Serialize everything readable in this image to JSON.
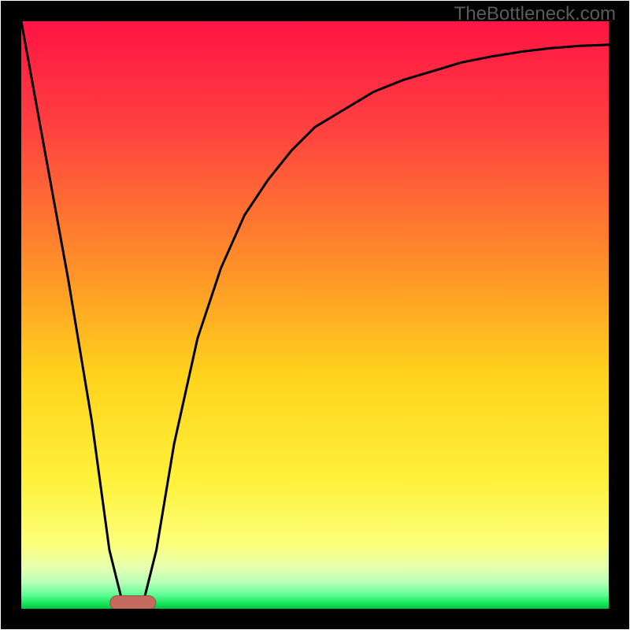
{
  "attribution": "TheBottleneck.com",
  "chart_data": {
    "type": "line",
    "title": "",
    "xlabel": "",
    "ylabel": "",
    "xlim": [
      0,
      100
    ],
    "ylim": [
      0,
      100
    ],
    "x": [
      0,
      4,
      8,
      12,
      15,
      17,
      19,
      21,
      23,
      26,
      30,
      34,
      38,
      42,
      46,
      50,
      55,
      60,
      65,
      70,
      75,
      80,
      85,
      90,
      95,
      100
    ],
    "y": [
      100,
      78,
      56,
      32,
      10,
      2,
      1,
      2,
      10,
      28,
      46,
      58,
      67,
      73,
      78,
      82,
      85,
      88,
      90,
      91.5,
      93,
      94,
      94.8,
      95.4,
      95.8,
      96
    ],
    "min_marker": {
      "x": 19,
      "y": 1
    },
    "background": "vertical gradient red→orange→yellow→pale-green with deep green band at bottom",
    "frame": "thick black border, no ticks, no axis labels"
  },
  "colors": {
    "frame": "#000000",
    "curve": "#000000",
    "marker_fill": "#c46a5f",
    "marker_stroke": "#9e4d44",
    "grad_stops": [
      {
        "offset": 0,
        "color": "#ff1444"
      },
      {
        "offset": 0.18,
        "color": "#ff4040"
      },
      {
        "offset": 0.4,
        "color": "#ff8a2a"
      },
      {
        "offset": 0.6,
        "color": "#ffd21c"
      },
      {
        "offset": 0.78,
        "color": "#fff13a"
      },
      {
        "offset": 0.89,
        "color": "#fbff7a"
      },
      {
        "offset": 0.93,
        "color": "#e6ffb0"
      },
      {
        "offset": 0.955,
        "color": "#b8ffb8"
      },
      {
        "offset": 0.975,
        "color": "#66ff99"
      },
      {
        "offset": 0.99,
        "color": "#18e860"
      },
      {
        "offset": 1.0,
        "color": "#00c83c"
      }
    ]
  },
  "geom": {
    "outer": 800,
    "pad": 27,
    "frame_stroke": 26
  }
}
